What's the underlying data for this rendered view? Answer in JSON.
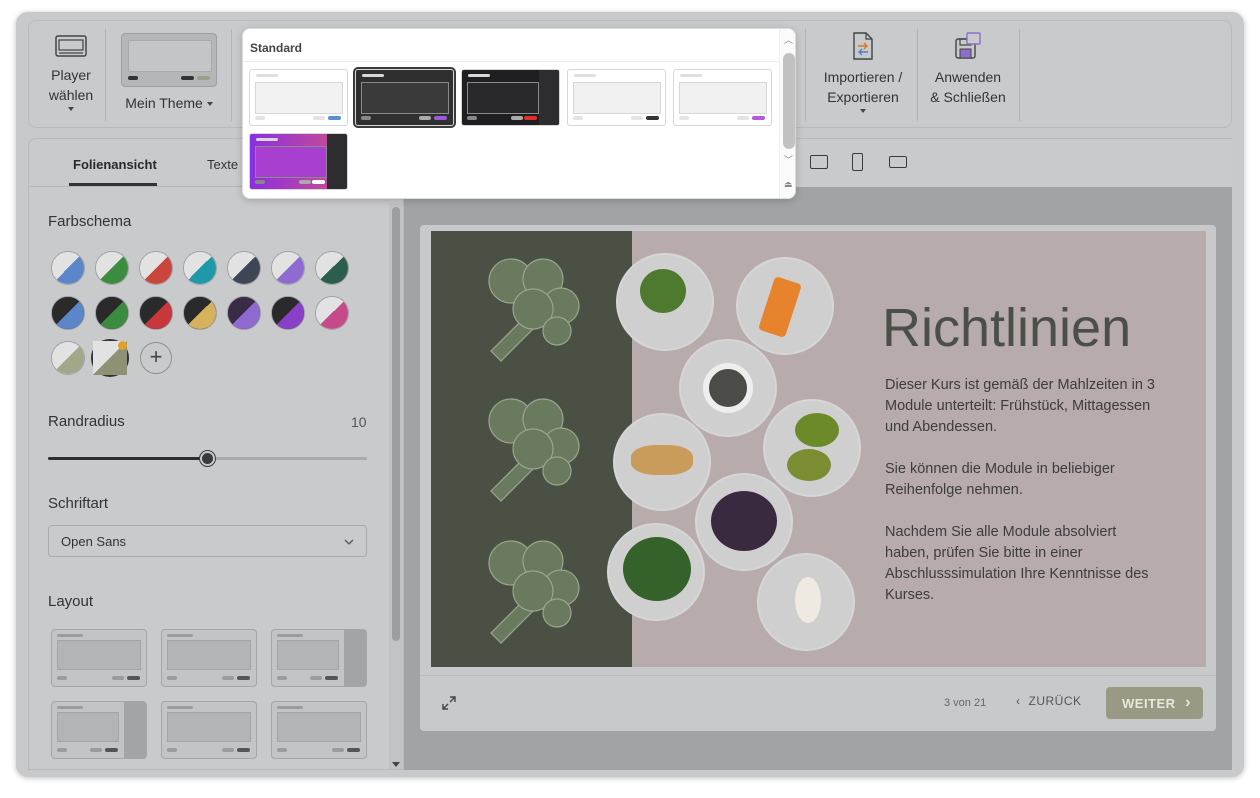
{
  "toolbar": {
    "player_label": "Player\nwählen",
    "theme_label": "Mein Theme",
    "import_label": "Importieren /\nExportieren",
    "apply_label": "Anwenden\n& Schließen"
  },
  "theme_dropdown": {
    "group_title": "Standard",
    "themes": [
      {
        "name": "light-blue",
        "bg": "#ffffff",
        "box": "#f2f2f2",
        "accent": "#5a8fd6",
        "selected": false
      },
      {
        "name": "dark-purple",
        "bg": "#2f2f2f",
        "box": "#3a3a3a",
        "accent": "#9a5ad9",
        "selected": true
      },
      {
        "name": "dark-red",
        "bg": "#1f1f21",
        "box": "#28282b",
        "accent": "#e03030",
        "selected": false
      },
      {
        "name": "light-dark",
        "bg": "#ffffff",
        "box": "#f0f0f0",
        "accent": "#333333",
        "selected": false
      },
      {
        "name": "light-purple",
        "bg": "#ffffff",
        "box": "#f0f0f0",
        "accent": "#b65ad9",
        "selected": false
      },
      {
        "name": "gradient-purple",
        "bg": "#8a2fe0",
        "box": "#a83fd0",
        "accent": "#ffffff",
        "selected": false
      }
    ]
  },
  "left_panel": {
    "tabs": [
      "Folienansicht",
      "Texte"
    ],
    "color_scheme_title": "Farbschema",
    "swatches": [
      {
        "base": "#e2e2e2",
        "accent": "#5b86c9"
      },
      {
        "base": "#e2e2e2",
        "accent": "#3b8c3f"
      },
      {
        "base": "#e2e2e2",
        "accent": "#c9463c"
      },
      {
        "base": "#e2e2e2",
        "accent": "#1f98a8"
      },
      {
        "base": "#e2e2e2",
        "accent": "#3c4654"
      },
      {
        "base": "#e2e2e2",
        "accent": "#8f6ad1"
      },
      {
        "base": "#e2e2e2",
        "accent": "#2c5e4e"
      },
      {
        "base": "#2a2a2a",
        "accent": "#5b86c9"
      },
      {
        "base": "#2a2a2a",
        "accent": "#3b8c3f"
      },
      {
        "base": "#2a2a2a",
        "accent": "#c9363c"
      },
      {
        "base": "#2a2a2a",
        "accent": "#d6b25c"
      },
      {
        "base": "#3a2c46",
        "accent": "#8f6ad1"
      },
      {
        "base": "#2a2a2a",
        "accent": "#8a3fc9"
      },
      {
        "base": "#e2e2e2",
        "accent": "#c64a8a"
      },
      {
        "base": "#e2e2e2",
        "accent": "#a2a78a"
      },
      {
        "base": "#e2e2e2",
        "accent": "#8e9173"
      }
    ],
    "radius_title": "Randradius",
    "radius_value": "10",
    "radius_fraction": 0.5,
    "font_title": "Schriftart",
    "font_value": "Open Sans",
    "layout_title": "Layout"
  },
  "slide": {
    "title": "Richtlinien",
    "paragraphs": [
      "Dieser Kurs ist gemäß der Mahlzeiten in 3 Module unterteilt: Frühstück, Mittagessen und Abendessen.",
      "Sie können die Module in beliebiger Reihenfolge nehmen.",
      "Nachdem Sie alle Module absolviert haben, prüfen Sie bitte in einer Abschlusssimulation Ihre Kenntnisse des Kurses."
    ],
    "counter": "3 von 21",
    "back_label": "ZURÜCK",
    "next_label": "WEITER"
  },
  "colors": {
    "accent": "#989a84",
    "slide_dark": "#4a5043",
    "slide_bg": "#b7abab"
  }
}
